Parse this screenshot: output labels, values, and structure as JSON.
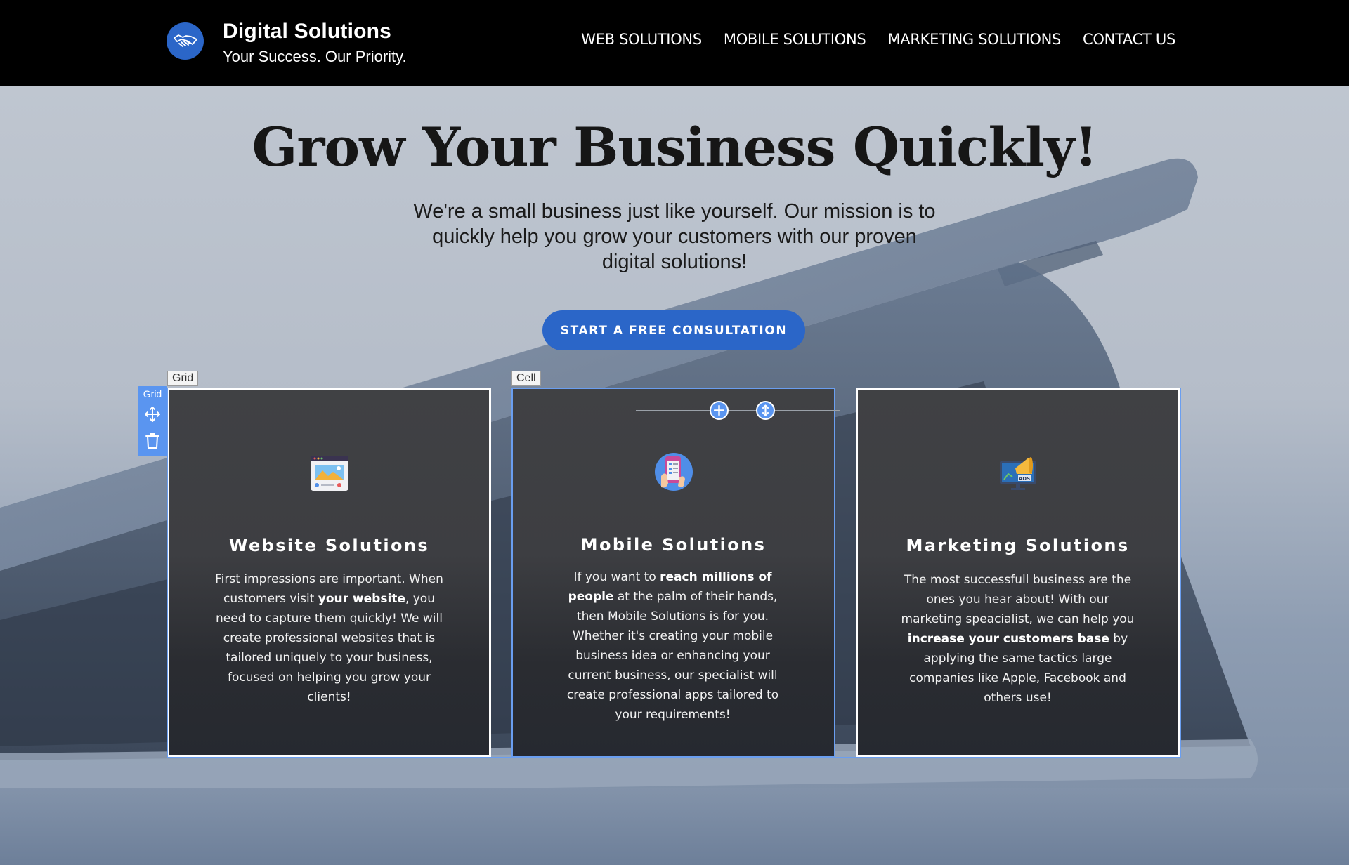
{
  "header": {
    "brand_name": "Digital Solutions",
    "brand_tagline": "Your Success. Our Priority.",
    "logo_icon": "handshake-icon",
    "nav": [
      {
        "label": "WEB SOLUTIONS"
      },
      {
        "label": "MOBILE SOLUTIONS"
      },
      {
        "label": "MARKETING SOLUTIONS"
      },
      {
        "label": "CONTACT US"
      }
    ]
  },
  "hero": {
    "title": "Grow Your Business Quickly!",
    "subtitle": "We're a small business just like yourself. Our mission is to quickly help you grow your customers with our proven digital solutions!",
    "cta_label": "START A FREE CONSULTATION"
  },
  "editor": {
    "grid_tag": "Grid",
    "cell_tag": "Cell",
    "grid_tools_label": "Grid"
  },
  "cards": [
    {
      "icon": "website-icon",
      "title": "Website Solutions",
      "body": [
        {
          "text": "First impressions are important. When customers visit ",
          "bold": false
        },
        {
          "text": "your website",
          "bold": true
        },
        {
          "text": ", you need to capture them quickly! We will create professional websites that is tailored uniquely to your business, focused on helping you grow your clients!",
          "bold": false
        }
      ]
    },
    {
      "icon": "mobile-app-icon",
      "title": "Mobile Solutions",
      "body": [
        {
          "text": "If you want to ",
          "bold": false
        },
        {
          "text": "reach millions of people",
          "bold": true
        },
        {
          "text": " at the palm of their hands, then Mobile Solutions is for you. Whether it's creating your mobile business idea or enhancing your current business, our specialist will create professional apps tailored to your requirements!",
          "bold": false
        }
      ]
    },
    {
      "icon": "megaphone-ads-icon",
      "title": "Marketing Solutions",
      "body": [
        {
          "text": "The most successfull business are the ones you hear about! With our marketing speacialist, we can help you ",
          "bold": false
        },
        {
          "text": "increase your customers base",
          "bold": true
        },
        {
          "text": " by applying the same tactics large companies like Apple, Facebook and others use!",
          "bold": false
        }
      ]
    }
  ],
  "colors": {
    "accent": "#2b66c8",
    "editor_blue": "#5a95f0",
    "header_bg": "#000000"
  }
}
